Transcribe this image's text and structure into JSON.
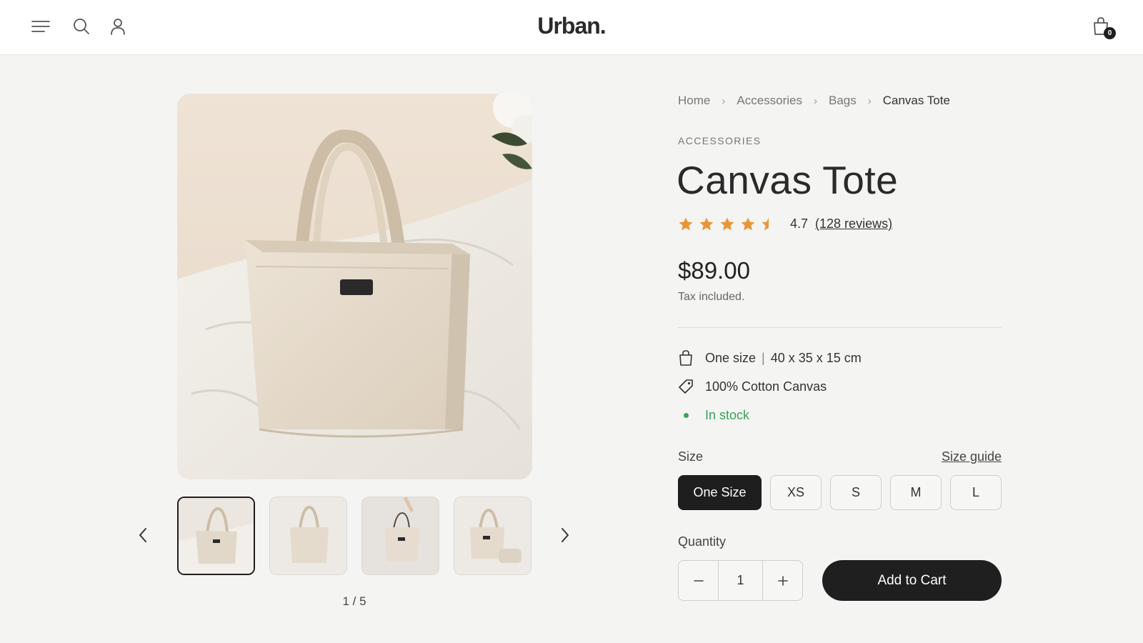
{
  "header": {
    "logo": "Urban.",
    "cart_count": "0"
  },
  "gallery": {
    "counter": "1 / 5",
    "active_index": 1,
    "total": 5
  },
  "breadcrumb": {
    "items": [
      "Home",
      "Accessories",
      "Bags",
      "Canvas Tote"
    ]
  },
  "product": {
    "category": "ACCESSORIES",
    "title": "Canvas Tote",
    "rating": 4.7,
    "rating_text": "4.7",
    "reviews": "(128 reviews)",
    "price": "$89.00",
    "tax_note": "Tax included.",
    "features": {
      "size": "One size",
      "dimensions": "40 x 35 x 15 cm",
      "material": "100% Cotton Canvas",
      "stock": "In stock"
    }
  },
  "size_selector": {
    "label": "Size",
    "guide": "Size guide",
    "options": [
      "One Size",
      "XS",
      "S",
      "M",
      "L"
    ],
    "selected": "One Size"
  },
  "quantity": {
    "label": "Quantity",
    "value": "1"
  },
  "cta": {
    "add_to_cart": "Add to Cart"
  },
  "colors": {
    "accent_star": "#e8963a",
    "stock_green": "#3aa35a",
    "dark": "#1e1e1e"
  }
}
